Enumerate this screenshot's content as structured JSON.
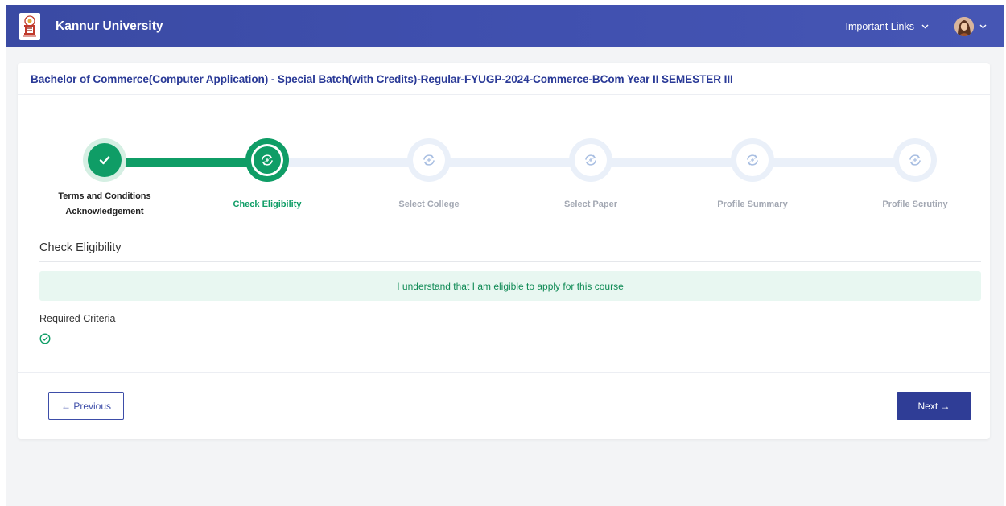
{
  "app": {
    "name": "Kannur University",
    "important_links": "Important Links"
  },
  "course": {
    "title": "Bachelor of Commerce(Computer Application) - Special Batch(with Credits)-Regular-FYUGP-2024-Commerce-BCom Year II SEMESTER III"
  },
  "steps": [
    {
      "line1": "Terms and Conditions",
      "line2": "Acknowledgement",
      "state": "completed",
      "icon": "check-icon"
    },
    {
      "line1": "Check Eligibility",
      "line2": "",
      "state": "active",
      "icon": "sync-icon"
    },
    {
      "line1": "Select College",
      "line2": "",
      "state": "pending",
      "icon": "sync-icon"
    },
    {
      "line1": "Select Paper",
      "line2": "",
      "state": "pending",
      "icon": "sync-icon"
    },
    {
      "line1": "Profile Summary",
      "line2": "",
      "state": "pending",
      "icon": "sync-icon"
    },
    {
      "line1": "Profile Scrutiny",
      "line2": "",
      "state": "pending",
      "icon": "sync-icon"
    }
  ],
  "section": {
    "title": "Check Eligibility",
    "notice": "I understand that I am eligible to apply for this course",
    "criteria_label": "Required Criteria",
    "criteria_icon": "check-circle-icon"
  },
  "buttons": {
    "previous": "← Previous",
    "next": "Next →"
  },
  "colors": {
    "primary": "#2f3d96",
    "success": "#0f9d66",
    "pending": "#b7c8e6",
    "track_pending": "#eaf0f9"
  }
}
